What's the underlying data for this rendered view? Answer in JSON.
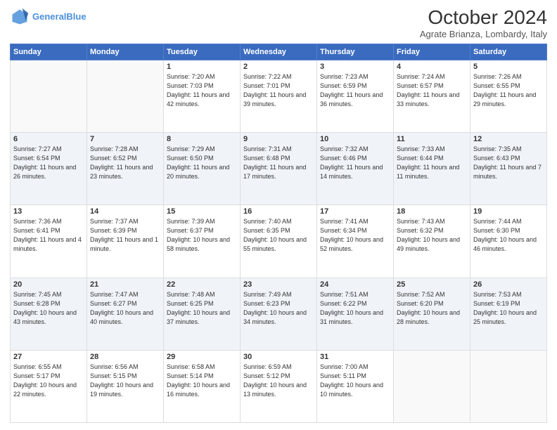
{
  "header": {
    "logo_line1": "General",
    "logo_line2": "Blue",
    "month_year": "October 2024",
    "location": "Agrate Brianza, Lombardy, Italy"
  },
  "weekdays": [
    "Sunday",
    "Monday",
    "Tuesday",
    "Wednesday",
    "Thursday",
    "Friday",
    "Saturday"
  ],
  "weeks": [
    [
      {
        "day": "",
        "info": ""
      },
      {
        "day": "",
        "info": ""
      },
      {
        "day": "1",
        "info": "Sunrise: 7:20 AM\nSunset: 7:03 PM\nDaylight: 11 hours and 42 minutes."
      },
      {
        "day": "2",
        "info": "Sunrise: 7:22 AM\nSunset: 7:01 PM\nDaylight: 11 hours and 39 minutes."
      },
      {
        "day": "3",
        "info": "Sunrise: 7:23 AM\nSunset: 6:59 PM\nDaylight: 11 hours and 36 minutes."
      },
      {
        "day": "4",
        "info": "Sunrise: 7:24 AM\nSunset: 6:57 PM\nDaylight: 11 hours and 33 minutes."
      },
      {
        "day": "5",
        "info": "Sunrise: 7:26 AM\nSunset: 6:55 PM\nDaylight: 11 hours and 29 minutes."
      }
    ],
    [
      {
        "day": "6",
        "info": "Sunrise: 7:27 AM\nSunset: 6:54 PM\nDaylight: 11 hours and 26 minutes."
      },
      {
        "day": "7",
        "info": "Sunrise: 7:28 AM\nSunset: 6:52 PM\nDaylight: 11 hours and 23 minutes."
      },
      {
        "day": "8",
        "info": "Sunrise: 7:29 AM\nSunset: 6:50 PM\nDaylight: 11 hours and 20 minutes."
      },
      {
        "day": "9",
        "info": "Sunrise: 7:31 AM\nSunset: 6:48 PM\nDaylight: 11 hours and 17 minutes."
      },
      {
        "day": "10",
        "info": "Sunrise: 7:32 AM\nSunset: 6:46 PM\nDaylight: 11 hours and 14 minutes."
      },
      {
        "day": "11",
        "info": "Sunrise: 7:33 AM\nSunset: 6:44 PM\nDaylight: 11 hours and 11 minutes."
      },
      {
        "day": "12",
        "info": "Sunrise: 7:35 AM\nSunset: 6:43 PM\nDaylight: 11 hours and 7 minutes."
      }
    ],
    [
      {
        "day": "13",
        "info": "Sunrise: 7:36 AM\nSunset: 6:41 PM\nDaylight: 11 hours and 4 minutes."
      },
      {
        "day": "14",
        "info": "Sunrise: 7:37 AM\nSunset: 6:39 PM\nDaylight: 11 hours and 1 minute."
      },
      {
        "day": "15",
        "info": "Sunrise: 7:39 AM\nSunset: 6:37 PM\nDaylight: 10 hours and 58 minutes."
      },
      {
        "day": "16",
        "info": "Sunrise: 7:40 AM\nSunset: 6:35 PM\nDaylight: 10 hours and 55 minutes."
      },
      {
        "day": "17",
        "info": "Sunrise: 7:41 AM\nSunset: 6:34 PM\nDaylight: 10 hours and 52 minutes."
      },
      {
        "day": "18",
        "info": "Sunrise: 7:43 AM\nSunset: 6:32 PM\nDaylight: 10 hours and 49 minutes."
      },
      {
        "day": "19",
        "info": "Sunrise: 7:44 AM\nSunset: 6:30 PM\nDaylight: 10 hours and 46 minutes."
      }
    ],
    [
      {
        "day": "20",
        "info": "Sunrise: 7:45 AM\nSunset: 6:28 PM\nDaylight: 10 hours and 43 minutes."
      },
      {
        "day": "21",
        "info": "Sunrise: 7:47 AM\nSunset: 6:27 PM\nDaylight: 10 hours and 40 minutes."
      },
      {
        "day": "22",
        "info": "Sunrise: 7:48 AM\nSunset: 6:25 PM\nDaylight: 10 hours and 37 minutes."
      },
      {
        "day": "23",
        "info": "Sunrise: 7:49 AM\nSunset: 6:23 PM\nDaylight: 10 hours and 34 minutes."
      },
      {
        "day": "24",
        "info": "Sunrise: 7:51 AM\nSunset: 6:22 PM\nDaylight: 10 hours and 31 minutes."
      },
      {
        "day": "25",
        "info": "Sunrise: 7:52 AM\nSunset: 6:20 PM\nDaylight: 10 hours and 28 minutes."
      },
      {
        "day": "26",
        "info": "Sunrise: 7:53 AM\nSunset: 6:19 PM\nDaylight: 10 hours and 25 minutes."
      }
    ],
    [
      {
        "day": "27",
        "info": "Sunrise: 6:55 AM\nSunset: 5:17 PM\nDaylight: 10 hours and 22 minutes."
      },
      {
        "day": "28",
        "info": "Sunrise: 6:56 AM\nSunset: 5:15 PM\nDaylight: 10 hours and 19 minutes."
      },
      {
        "day": "29",
        "info": "Sunrise: 6:58 AM\nSunset: 5:14 PM\nDaylight: 10 hours and 16 minutes."
      },
      {
        "day": "30",
        "info": "Sunrise: 6:59 AM\nSunset: 5:12 PM\nDaylight: 10 hours and 13 minutes."
      },
      {
        "day": "31",
        "info": "Sunrise: 7:00 AM\nSunset: 5:11 PM\nDaylight: 10 hours and 10 minutes."
      },
      {
        "day": "",
        "info": ""
      },
      {
        "day": "",
        "info": ""
      }
    ]
  ]
}
